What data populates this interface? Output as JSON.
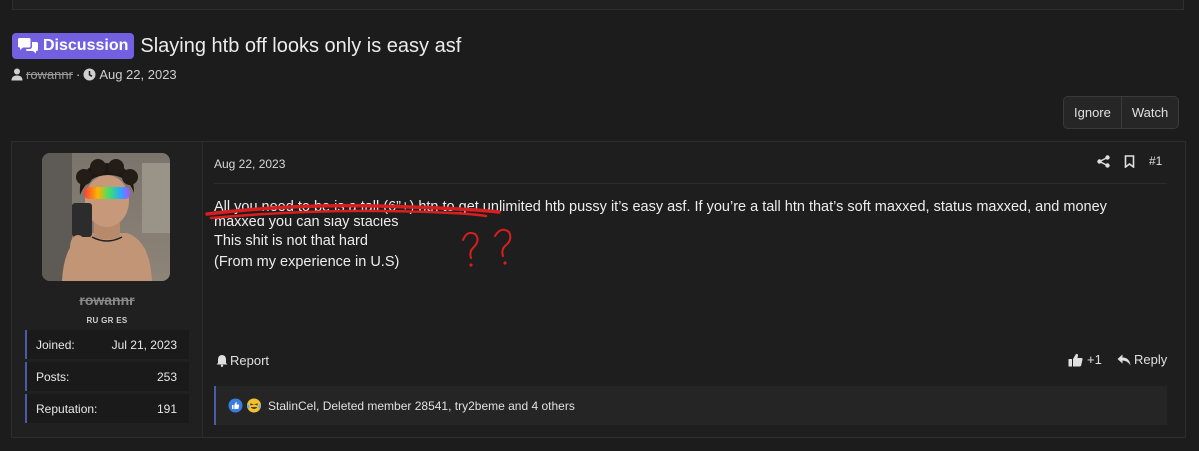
{
  "thread": {
    "prefix": "Discussion",
    "title": "Slaying htb off looks only is easy asf",
    "author": "rowannr",
    "date": "Aug 22, 2023",
    "meta_separator": "·"
  },
  "thread_actions": {
    "ignore": "Ignore",
    "watch": "Watch"
  },
  "post": {
    "author": {
      "username": "rowannr",
      "title": "RU GR ES",
      "stats": [
        {
          "label": "Joined:",
          "value": "Jul 21, 2023"
        },
        {
          "label": "Posts:",
          "value": "253"
        },
        {
          "label": "Reputation:",
          "value": "191"
        }
      ]
    },
    "date": "Aug 22, 2023",
    "number": "#1",
    "body": [
      "All you need to be is a tall (6”+) htn to get unlimited htb pussy it’s easy asf. If you’re a tall htn that’s soft maxxed, status maxxed, and money",
      "maxxed you can slay stacies",
      "This shit is not that hard",
      "(From my experience in U.S)"
    ],
    "report_label": "Report",
    "like_count": "+1",
    "reply_label": "Reply",
    "reactions_text": "StalinCel, Deleted member 28541, try2beme and 4 others"
  },
  "colors": {
    "background": "#1c1c1c",
    "prefix_badge": "#7360e0",
    "accent_border": "#4b5ba8",
    "annotation_red": "#d81e1e"
  },
  "icons": [
    "chat-bubbles-icon",
    "user-icon",
    "clock-icon",
    "share-icon",
    "bookmark-icon",
    "bell-icon",
    "thumbs-up-icon",
    "reply-arrow-icon",
    "like-reaction-icon",
    "laugh-reaction-icon"
  ]
}
